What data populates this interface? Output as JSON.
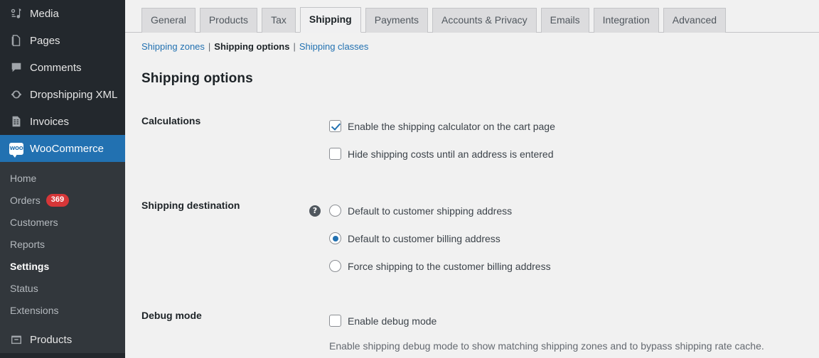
{
  "sidebar": {
    "items": [
      {
        "label": "Media",
        "icon": "media-icon",
        "type": "top"
      },
      {
        "label": "Pages",
        "icon": "pages-icon",
        "type": "top"
      },
      {
        "label": "Comments",
        "icon": "comments-icon",
        "type": "top"
      },
      {
        "label": "Dropshipping XML",
        "icon": "sync-icon",
        "type": "top"
      },
      {
        "label": "Invoices",
        "icon": "invoice-icon",
        "type": "top"
      },
      {
        "label": "WooCommerce",
        "icon": "woocommerce-icon",
        "type": "top",
        "current": true
      }
    ],
    "submenu": [
      {
        "label": "Home"
      },
      {
        "label": "Orders",
        "badge": "369"
      },
      {
        "label": "Customers"
      },
      {
        "label": "Reports"
      },
      {
        "label": "Settings",
        "active": true
      },
      {
        "label": "Status"
      },
      {
        "label": "Extensions"
      }
    ],
    "bottom_item": {
      "label": "Products",
      "icon": "products-icon"
    },
    "accent_color": "#2271b1",
    "badge_color": "#d63638",
    "background_color": "#23282d"
  },
  "tabs": [
    {
      "label": "General",
      "active": false
    },
    {
      "label": "Products",
      "active": false
    },
    {
      "label": "Tax",
      "active": false
    },
    {
      "label": "Shipping",
      "active": true
    },
    {
      "label": "Payments",
      "active": false
    },
    {
      "label": "Accounts & Privacy",
      "active": false
    },
    {
      "label": "Emails",
      "active": false
    },
    {
      "label": "Integration",
      "active": false
    },
    {
      "label": "Advanced",
      "active": false
    }
  ],
  "subnav": {
    "zones": "Shipping zones",
    "options": "Shipping options",
    "classes": "Shipping classes",
    "separator": "|"
  },
  "page": {
    "title": "Shipping options"
  },
  "sections": {
    "calculations": {
      "label": "Calculations",
      "options": [
        {
          "label": "Enable the shipping calculator on the cart page",
          "checked": true
        },
        {
          "label": "Hide shipping costs until an address is entered",
          "checked": false
        }
      ]
    },
    "shipping_destination": {
      "label": "Shipping destination",
      "help_icon": "help-icon",
      "options": [
        {
          "label": "Default to customer shipping address",
          "selected": false
        },
        {
          "label": "Default to customer billing address",
          "selected": true
        },
        {
          "label": "Force shipping to the customer billing address",
          "selected": false
        }
      ]
    },
    "debug_mode": {
      "label": "Debug mode",
      "option": {
        "label": "Enable debug mode",
        "checked": false
      },
      "description": "Enable shipping debug mode to show matching shipping zones and to bypass shipping rate cache."
    }
  }
}
